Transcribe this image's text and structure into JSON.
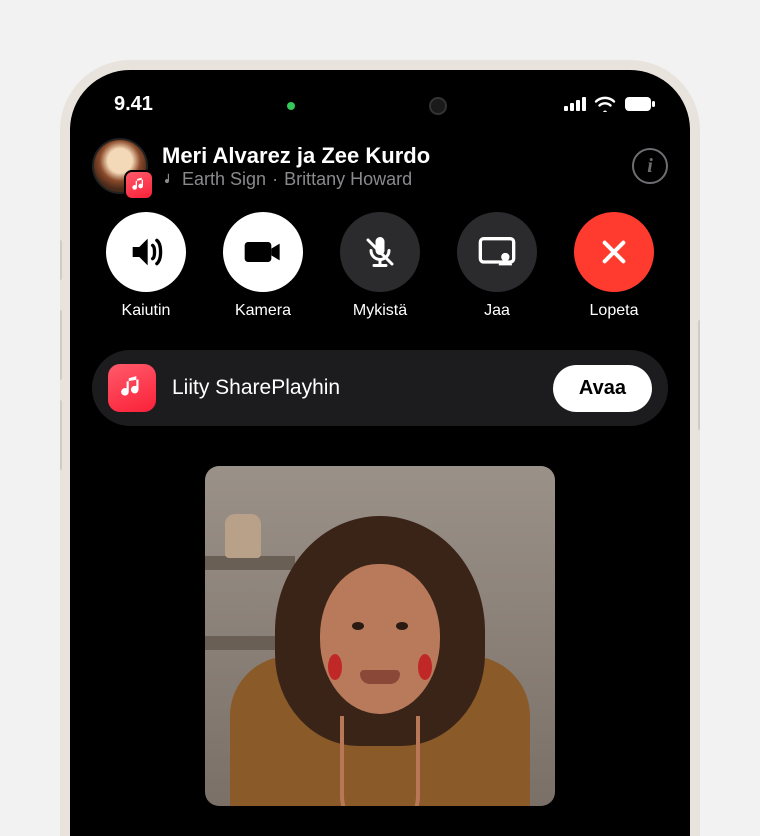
{
  "status": {
    "time": "9.41"
  },
  "call": {
    "title": "Meri Alvarez ja Zee Kurdo",
    "song": "Earth Sign",
    "artist": "Brittany Howard",
    "separator": "·"
  },
  "controls": {
    "speaker": "Kaiutin",
    "camera": "Kamera",
    "mute": "Mykistä",
    "share": "Jaa",
    "end": "Lopeta"
  },
  "shareplay": {
    "text": "Liity SharePlayhin",
    "open": "Avaa"
  },
  "info_label": "i",
  "colors": {
    "accent_red": "#ff3b30",
    "music_gradient_start": "#ff5a6a",
    "music_gradient_end": "#fa2139"
  }
}
